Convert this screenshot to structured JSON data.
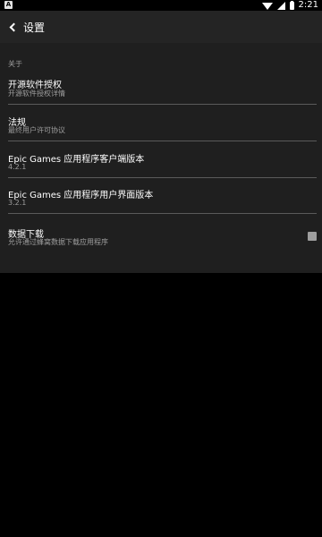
{
  "status_bar": {
    "time": "2:21",
    "app_indicator": "A",
    "icons": [
      "wifi-icon",
      "signal-icon",
      "battery-icon"
    ]
  },
  "app_bar": {
    "title": "设置",
    "back_icon": "back-arrow-icon"
  },
  "settings": {
    "section_header": "关于",
    "items": [
      {
        "title": "开源软件授权",
        "subtitle": "开源软件授权详情"
      },
      {
        "title": "法规",
        "subtitle": "最终用户许可协议"
      },
      {
        "title": "Epic Games 应用程序客户端版本",
        "subtitle": "4.2.1"
      },
      {
        "title": "Epic Games 应用程序用户界面版本",
        "subtitle": "3.2.1"
      },
      {
        "title": "数据下载",
        "subtitle": "允许通过蜂窝数据下载应用程序",
        "checkbox_checked": false
      }
    ]
  },
  "colors": {
    "background": "#000000",
    "panel": "#1f1f1f",
    "app_bar": "#242424",
    "secondary_text": "#9e9e9e",
    "divider": "#5a5a5a"
  }
}
